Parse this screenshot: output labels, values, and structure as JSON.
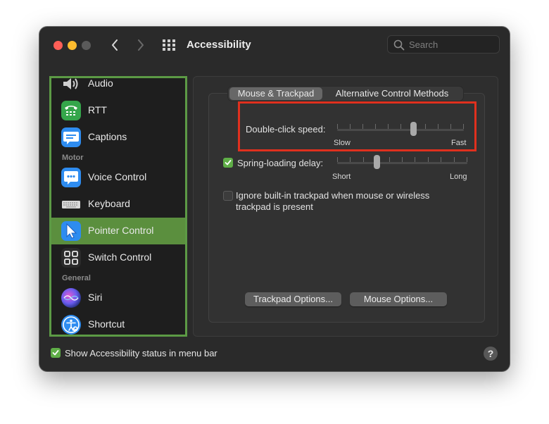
{
  "window": {
    "title": "Accessibility"
  },
  "search": {
    "placeholder": "Search"
  },
  "sidebar": {
    "items": [
      {
        "label": "Audio",
        "icon": "speaker-icon"
      },
      {
        "label": "RTT",
        "icon": "rtt-phone-icon"
      },
      {
        "label": "Captions",
        "icon": "captions-icon"
      },
      {
        "label": "Voice Control",
        "icon": "voice-control-icon"
      },
      {
        "label": "Keyboard",
        "icon": "keyboard-icon"
      },
      {
        "label": "Pointer Control",
        "icon": "pointer-icon",
        "selected": true
      },
      {
        "label": "Switch Control",
        "icon": "switch-control-icon"
      },
      {
        "label": "Siri",
        "icon": "siri-icon"
      },
      {
        "label": "Shortcut",
        "icon": "accessibility-shortcut-icon"
      }
    ],
    "sections": {
      "motor": "Motor",
      "general": "General"
    }
  },
  "tabs": {
    "mouse_trackpad": "Mouse & Trackpad",
    "alternative": "Alternative Control Methods"
  },
  "settings": {
    "double_click": {
      "label": "Double-click speed:",
      "min_label": "Slow",
      "max_label": "Fast",
      "value": 0.6
    },
    "spring_loading": {
      "label": "Spring-loading delay:",
      "checked": true,
      "min_label": "Short",
      "max_label": "Long",
      "value": 0.3
    },
    "ignore_trackpad": {
      "label_line1": "Ignore built-in trackpad when mouse or wireless",
      "label_line2": "trackpad is present",
      "checked": false
    }
  },
  "buttons": {
    "trackpad_options": "Trackpad Options...",
    "mouse_options": "Mouse Options..."
  },
  "footer": {
    "status_label": "Show Accessibility status in menu bar",
    "status_checked": true,
    "help": "?"
  },
  "colors": {
    "accent": "#5b8f3e",
    "checkbox": "#5fae47",
    "highlight": "#e0301e"
  }
}
